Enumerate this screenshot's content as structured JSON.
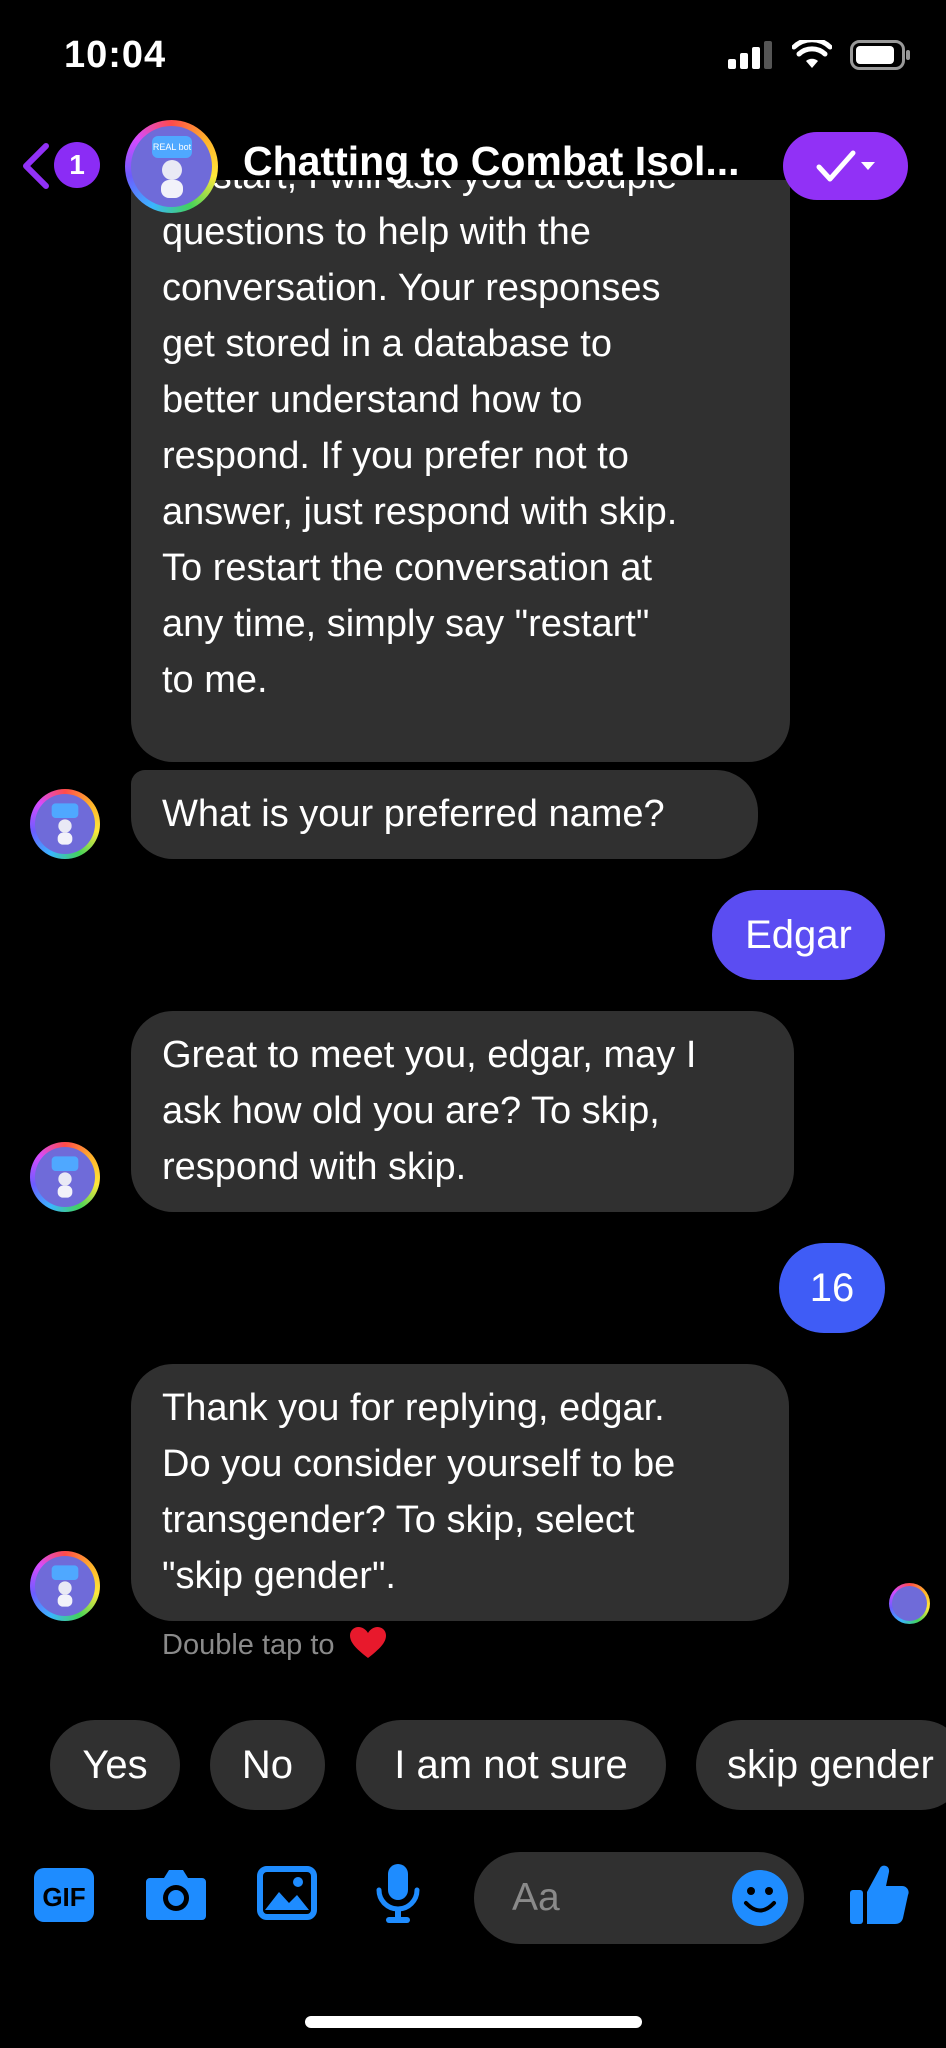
{
  "status_bar": {
    "time": "10:04"
  },
  "header": {
    "back_badge": "1",
    "title": "Chatting to Combat Isol...",
    "avatar_text": "REAL bot"
  },
  "messages": {
    "intro_partial": "To start, I will ask you a couple",
    "intro_lines": [
      "questions to help with the",
      "conversation. Your responses",
      "get stored in a database to",
      "better understand how to",
      "respond. If you prefer not to",
      "answer, just respond with skip.",
      "To restart the conversation at",
      "any time, simply say \"restart\"",
      "to me."
    ],
    "name_question": "What is your preferred name?",
    "user_name": "Edgar",
    "age_question": [
      "Great to meet you, edgar, may I",
      "ask how old you are? To skip,",
      "respond with skip."
    ],
    "user_age": "16",
    "gender_question": [
      "Thank you for replying, edgar.",
      "Do you consider yourself to be",
      "transgender? To skip, select",
      "\"skip gender\"."
    ],
    "hint": "Double tap to"
  },
  "quick_replies": [
    "Yes",
    "No",
    "I am not sure",
    "skip gender"
  ],
  "composer": {
    "placeholder": "Aa"
  },
  "colors": {
    "accent": "#9131f6",
    "out_bubble_1": "#5b4df2",
    "out_bubble_2": "#3f5cf6",
    "icon_blue": "#1e8cff",
    "bubble_bg": "#303030"
  }
}
